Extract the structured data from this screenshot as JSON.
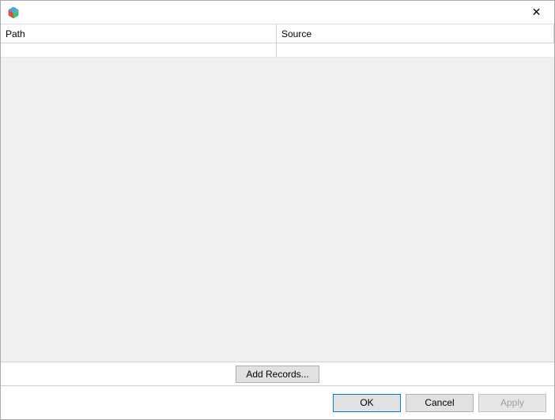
{
  "titlebar": {
    "close_symbol": "✕"
  },
  "table": {
    "columns": {
      "path": "Path",
      "source": "Source"
    },
    "rows": []
  },
  "actions": {
    "add_records": "Add Records..."
  },
  "footer": {
    "ok": "OK",
    "cancel": "Cancel",
    "apply": "Apply"
  }
}
